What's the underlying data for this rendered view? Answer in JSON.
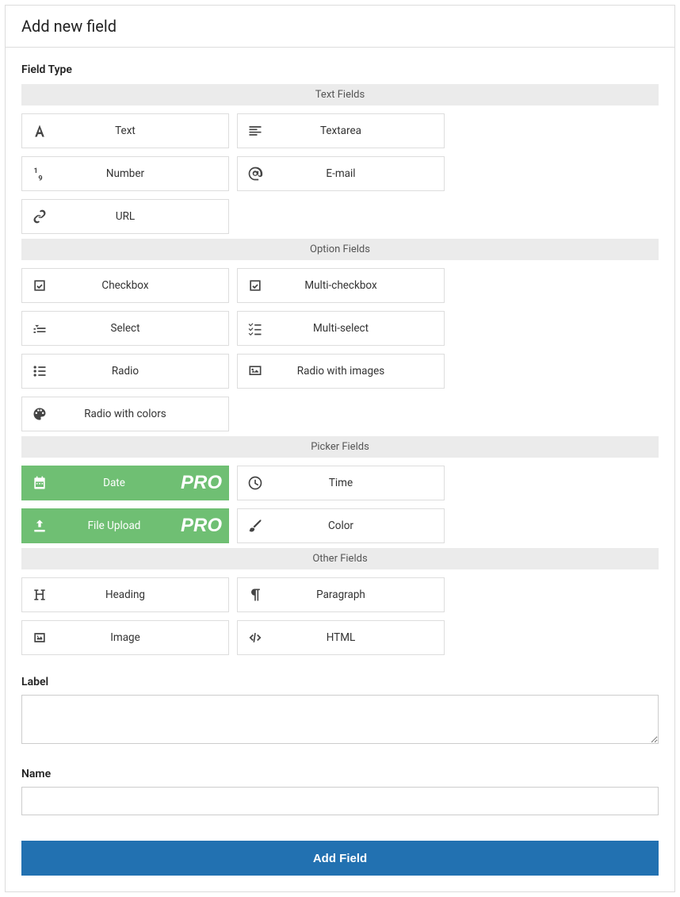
{
  "header": {
    "title": "Add new field"
  },
  "field_type_label": "Field Type",
  "groups": [
    {
      "title": "Text Fields",
      "items": [
        {
          "label": "Text",
          "icon": "font",
          "name": "text"
        },
        {
          "label": "Textarea",
          "icon": "align-left",
          "name": "textarea"
        },
        {
          "label": "Number",
          "icon": "number",
          "name": "number"
        },
        {
          "label": "E-mail",
          "icon": "at",
          "name": "email"
        },
        {
          "label": "URL",
          "icon": "link",
          "name": "url"
        }
      ]
    },
    {
      "title": "Option Fields",
      "items": [
        {
          "label": "Checkbox",
          "icon": "check-square",
          "name": "checkbox"
        },
        {
          "label": "Multi-checkbox",
          "icon": "check-square",
          "name": "multi-checkbox"
        },
        {
          "label": "Select",
          "icon": "select",
          "name": "select"
        },
        {
          "label": "Multi-select",
          "icon": "multi-select",
          "name": "multi-select"
        },
        {
          "label": "Radio",
          "icon": "list",
          "name": "radio"
        },
        {
          "label": "Radio with images",
          "icon": "image",
          "name": "radio-images"
        },
        {
          "label": "Radio with colors",
          "icon": "palette",
          "name": "radio-colors"
        }
      ]
    },
    {
      "title": "Picker Fields",
      "items": [
        {
          "label": "Date",
          "icon": "calendar",
          "name": "date",
          "pro": true
        },
        {
          "label": "Time",
          "icon": "clock",
          "name": "time"
        },
        {
          "label": "File Upload",
          "icon": "upload",
          "name": "file-upload",
          "pro": true
        },
        {
          "label": "Color",
          "icon": "brush",
          "name": "color"
        }
      ]
    },
    {
      "title": "Other Fields",
      "items": [
        {
          "label": "Heading",
          "icon": "heading",
          "name": "heading"
        },
        {
          "label": "Paragraph",
          "icon": "paragraph",
          "name": "paragraph"
        },
        {
          "label": "Image",
          "icon": "image-small",
          "name": "image"
        },
        {
          "label": "HTML",
          "icon": "code",
          "name": "html"
        }
      ]
    }
  ],
  "pro_badge": "PRO",
  "label_field": {
    "label": "Label",
    "value": ""
  },
  "name_field": {
    "label": "Name",
    "value": ""
  },
  "submit": {
    "label": "Add Field"
  }
}
